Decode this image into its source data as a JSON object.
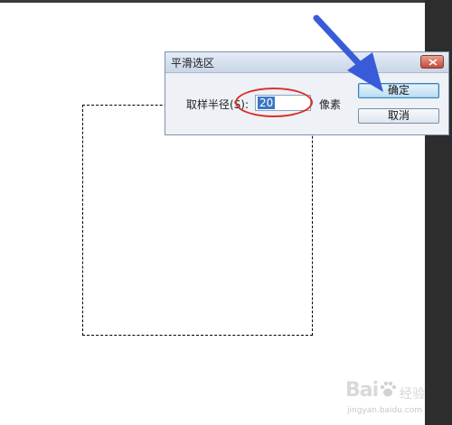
{
  "dialog": {
    "title": "平滑选区",
    "radius_label": "取样半径(S):",
    "radius_value": "20",
    "unit_label": "像素",
    "ok_label": "确定",
    "cancel_label": "取消"
  },
  "watermark": {
    "brand": "Bai",
    "suffix": "经验",
    "domain": "jingyan.baidu.com"
  },
  "annotations": {
    "arrow_color": "#3a5bd9",
    "circle_color": "#d9302a"
  }
}
